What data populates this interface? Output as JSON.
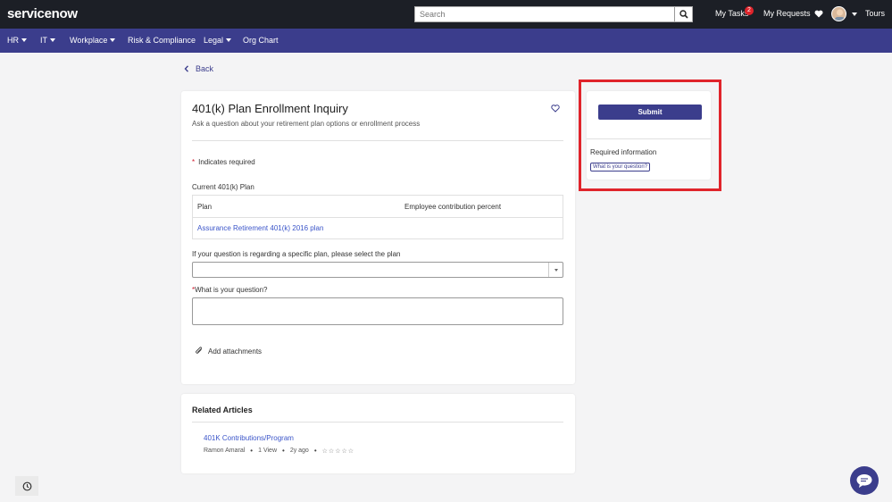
{
  "header": {
    "logo": "servicenow",
    "search_placeholder": "Search",
    "my_tasks": "My Tasks",
    "my_tasks_count": "2",
    "my_requests": "My Requests",
    "tours": "Tours"
  },
  "nav": {
    "items": [
      {
        "label": "HR",
        "dropdown": true
      },
      {
        "label": "IT",
        "dropdown": true
      },
      {
        "label": "Workplace",
        "dropdown": true
      },
      {
        "label": "Risk & Compliance",
        "dropdown": false
      },
      {
        "label": "Legal",
        "dropdown": true
      },
      {
        "label": "Org Chart",
        "dropdown": false
      }
    ]
  },
  "back_label": "Back",
  "form": {
    "title": "401(k) Plan Enrollment Inquiry",
    "subtitle": "Ask a question about your retirement plan options or enrollment process",
    "required_note": "Indicates required",
    "current_plan_label": "Current 401(k) Plan",
    "table": {
      "headers": [
        "Plan",
        "Employee contribution percent"
      ],
      "rows": [
        [
          "Assurance Retirement 401(k) 2016 plan",
          ""
        ]
      ]
    },
    "select_label": "If your question is regarding a specific plan, please select the plan",
    "select_value": "",
    "question_label": "What is your question?",
    "question_value": "",
    "attach_label": "Add attachments"
  },
  "related": {
    "title": "Related Articles",
    "article": {
      "title": "401K Contributions/Program",
      "author": "Ramon Amaral",
      "views": "1 View",
      "age": "2y ago",
      "rating": "☆☆☆☆☆"
    }
  },
  "side": {
    "submit_label": "Submit",
    "required_info": "Required information",
    "required_chip": "What is your question?"
  },
  "colors": {
    "topbar": "#1c1f26",
    "navbar": "#3b3d8c",
    "accent": "#3b3d8c",
    "link": "#3b55c9",
    "highlight": "#e0242b"
  }
}
